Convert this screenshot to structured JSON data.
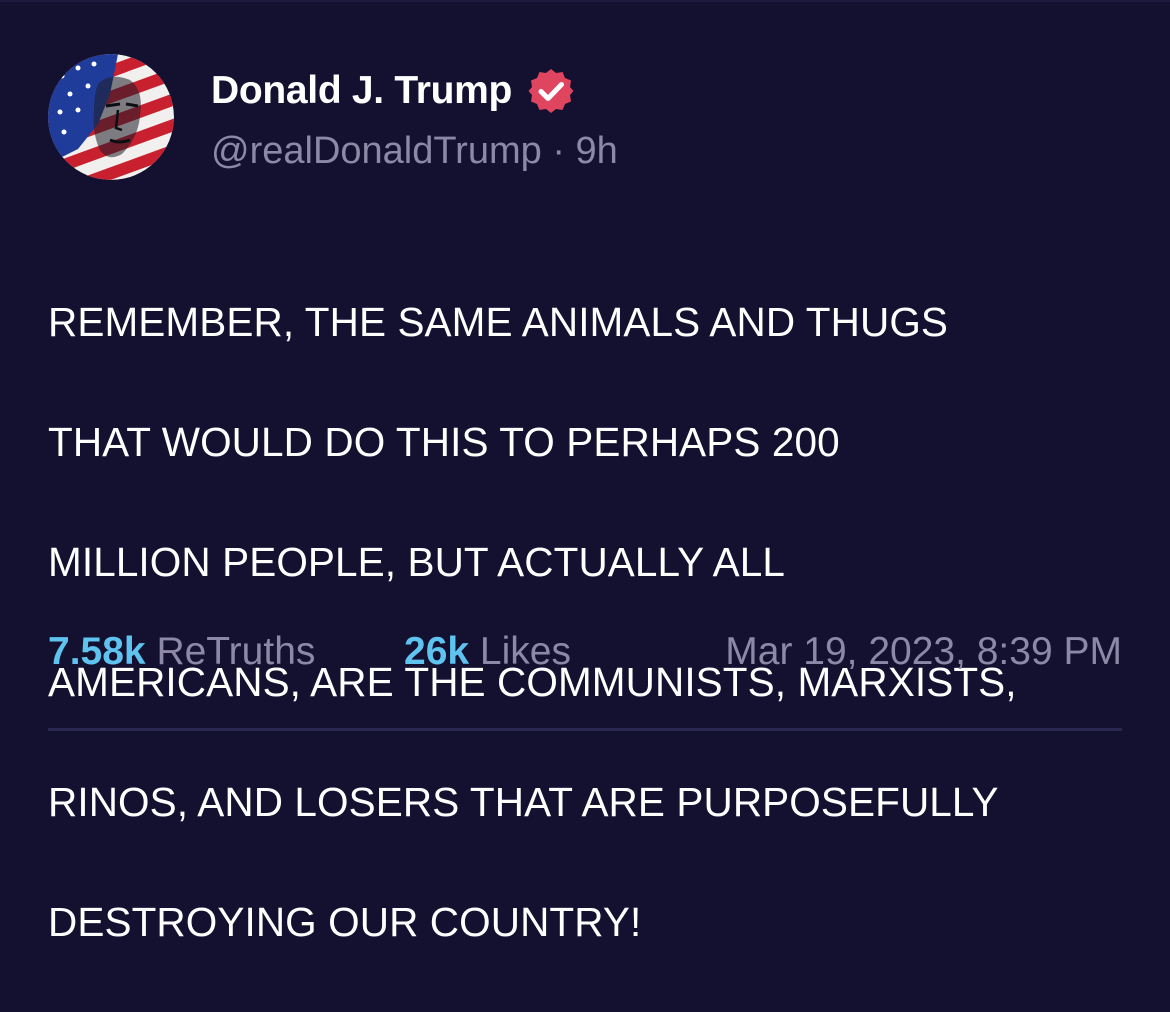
{
  "post": {
    "author": {
      "display_name": "Donald J. Trump",
      "handle": "@realDonaldTrump",
      "verified": true,
      "verified_badge_color": "#e0455f"
    },
    "time_separator": "·",
    "relative_time": "9h",
    "text_lines": [
      "REMEMBER, THE SAME ANIMALS AND THUGS",
      "THAT WOULD DO THIS TO PERHAPS 200",
      "MILLION PEOPLE, BUT ACTUALLY ALL",
      "AMERICANS, ARE THE COMMUNISTS, MARXISTS,",
      "RINOS, AND LOSERS THAT ARE PURPOSEFULLY",
      "DESTROYING OUR COUNTRY!"
    ],
    "stats": {
      "retruths_value": "7.58k",
      "retruths_label": "ReTruths",
      "likes_value": "26k",
      "likes_label": "Likes"
    },
    "timestamp": "Mar 19, 2023, 8:39 PM"
  },
  "theme": {
    "background": "#141130",
    "accent": "#5ec3ef",
    "muted_text": "#8c88a5"
  },
  "icons": {
    "avatar": "avatar-flag-portrait",
    "verified": "verified-badge-icon"
  }
}
